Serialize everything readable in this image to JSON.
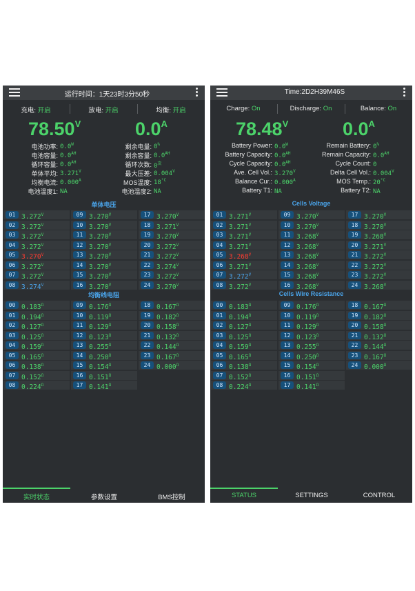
{
  "left": {
    "title": "运行时间：1天23时3分50秒",
    "toggles": [
      {
        "label": "充电:",
        "value": "开启"
      },
      {
        "label": "放电:",
        "value": "开启"
      },
      {
        "label": "均衡:",
        "value": "开启"
      }
    ],
    "voltage": {
      "value": "78.50",
      "unit": "V"
    },
    "current": {
      "value": "0.0",
      "unit": "A"
    },
    "stats_left": [
      {
        "label": "电池功率:",
        "value": "0.0",
        "unit": "W"
      },
      {
        "label": "电池容量:",
        "value": "0.0",
        "unit": "AH"
      },
      {
        "label": "循环容量:",
        "value": "0.0",
        "unit": "AH"
      },
      {
        "label": "单体平均:",
        "value": "3.271",
        "unit": "V"
      },
      {
        "label": "均衡电流:",
        "value": "0.000",
        "unit": "A"
      },
      {
        "label": "电池温度1:",
        "value": "NA",
        "unit": ""
      }
    ],
    "stats_right": [
      {
        "label": "剩余电量:",
        "value": "0",
        "unit": "%"
      },
      {
        "label": "剩余容量:",
        "value": "0.0",
        "unit": "AH"
      },
      {
        "label": "循环次数:",
        "value": "0",
        "unit": "次"
      },
      {
        "label": "最大压差:",
        "value": "0.004",
        "unit": "V"
      },
      {
        "label": "MOS温度:",
        "value": "18",
        "unit": "°C"
      },
      {
        "label": "电池温度2:",
        "value": "NA",
        "unit": ""
      }
    ],
    "cells_title": "单体电压",
    "cells": [
      {
        "id": "01",
        "value": "3.272",
        "unit": "V",
        "color": "green"
      },
      {
        "id": "09",
        "value": "3.270",
        "unit": "V",
        "color": "green"
      },
      {
        "id": "17",
        "value": "3.270",
        "unit": "V",
        "color": "green"
      },
      {
        "id": "02",
        "value": "3.272",
        "unit": "V",
        "color": "green"
      },
      {
        "id": "10",
        "value": "3.270",
        "unit": "V",
        "color": "green"
      },
      {
        "id": "18",
        "value": "3.271",
        "unit": "V",
        "color": "green"
      },
      {
        "id": "03",
        "value": "3.272",
        "unit": "V",
        "color": "green"
      },
      {
        "id": "11",
        "value": "3.270",
        "unit": "V",
        "color": "green"
      },
      {
        "id": "19",
        "value": "3.270",
        "unit": "V",
        "color": "green"
      },
      {
        "id": "04",
        "value": "3.272",
        "unit": "V",
        "color": "green"
      },
      {
        "id": "12",
        "value": "3.270",
        "unit": "V",
        "color": "green"
      },
      {
        "id": "20",
        "value": "3.272",
        "unit": "V",
        "color": "green"
      },
      {
        "id": "05",
        "value": "3.270",
        "unit": "V",
        "color": "red"
      },
      {
        "id": "13",
        "value": "3.270",
        "unit": "V",
        "color": "green"
      },
      {
        "id": "21",
        "value": "3.272",
        "unit": "V",
        "color": "green"
      },
      {
        "id": "06",
        "value": "3.272",
        "unit": "V",
        "color": "green"
      },
      {
        "id": "14",
        "value": "3.270",
        "unit": "V",
        "color": "green"
      },
      {
        "id": "22",
        "value": "3.274",
        "unit": "V",
        "color": "green"
      },
      {
        "id": "07",
        "value": "3.272",
        "unit": "V",
        "color": "green"
      },
      {
        "id": "15",
        "value": "3.270",
        "unit": "V",
        "color": "green"
      },
      {
        "id": "23",
        "value": "3.272",
        "unit": "V",
        "color": "green"
      },
      {
        "id": "08",
        "value": "3.274",
        "unit": "V",
        "color": "blue"
      },
      {
        "id": "16",
        "value": "3.270",
        "unit": "V",
        "color": "green"
      },
      {
        "id": "24",
        "value": "3.270",
        "unit": "V",
        "color": "green"
      }
    ],
    "res_title": "均衡线电阻",
    "res": [
      {
        "id": "00",
        "value": "0.183",
        "unit": "Ω"
      },
      {
        "id": "09",
        "value": "0.176",
        "unit": "Ω"
      },
      {
        "id": "18",
        "value": "0.167",
        "unit": "Ω"
      },
      {
        "id": "01",
        "value": "0.194",
        "unit": "Ω"
      },
      {
        "id": "10",
        "value": "0.119",
        "unit": "Ω"
      },
      {
        "id": "19",
        "value": "0.182",
        "unit": "Ω"
      },
      {
        "id": "02",
        "value": "0.127",
        "unit": "Ω"
      },
      {
        "id": "11",
        "value": "0.129",
        "unit": "Ω"
      },
      {
        "id": "20",
        "value": "0.158",
        "unit": "Ω"
      },
      {
        "id": "03",
        "value": "0.125",
        "unit": "Ω"
      },
      {
        "id": "12",
        "value": "0.123",
        "unit": "Ω"
      },
      {
        "id": "21",
        "value": "0.132",
        "unit": "Ω"
      },
      {
        "id": "04",
        "value": "0.159",
        "unit": "Ω"
      },
      {
        "id": "13",
        "value": "0.255",
        "unit": "Ω"
      },
      {
        "id": "22",
        "value": "0.144",
        "unit": "Ω"
      },
      {
        "id": "05",
        "value": "0.165",
        "unit": "Ω"
      },
      {
        "id": "14",
        "value": "0.250",
        "unit": "Ω"
      },
      {
        "id": "23",
        "value": "0.167",
        "unit": "Ω"
      },
      {
        "id": "06",
        "value": "0.138",
        "unit": "Ω"
      },
      {
        "id": "15",
        "value": "0.154",
        "unit": "Ω"
      },
      {
        "id": "24",
        "value": "0.000",
        "unit": "Ω"
      },
      {
        "id": "07",
        "value": "0.152",
        "unit": "Ω"
      },
      {
        "id": "16",
        "value": "0.151",
        "unit": "Ω"
      },
      {
        "id": "08",
        "value": "0.224",
        "unit": "Ω"
      },
      {
        "id": "17",
        "value": "0.141",
        "unit": "Ω"
      }
    ],
    "nav": [
      "实时状态",
      "参数设置",
      "BMS控制"
    ]
  },
  "right": {
    "title": "Time:2D2H39M46S",
    "toggles": [
      {
        "label": "Charge:",
        "value": "On"
      },
      {
        "label": "Discharge:",
        "value": "On"
      },
      {
        "label": "Balance:",
        "value": "On"
      }
    ],
    "voltage": {
      "value": "78.48",
      "unit": "V"
    },
    "current": {
      "value": "0.0",
      "unit": "A"
    },
    "stats_left": [
      {
        "label": "Battery Power:",
        "value": "0.0",
        "unit": "W"
      },
      {
        "label": "Battery Capacity:",
        "value": "0.0",
        "unit": "AH"
      },
      {
        "label": "Cycle Capacity:",
        "value": "0.0",
        "unit": "AH"
      },
      {
        "label": "Ave. Cell Vol.:",
        "value": "3.270",
        "unit": "V"
      },
      {
        "label": "Balance Cur.:",
        "value": "0.000",
        "unit": "A"
      },
      {
        "label": "Battery T1:",
        "value": "NA",
        "unit": ""
      }
    ],
    "stats_right": [
      {
        "label": "Remain Battery:",
        "value": "0",
        "unit": "%"
      },
      {
        "label": "Remain Capacity:",
        "value": "0.0",
        "unit": "AH"
      },
      {
        "label": "Cycle Count:",
        "value": "0",
        "unit": ""
      },
      {
        "label": "Delta Cell Vol.:",
        "value": "0.004",
        "unit": "V"
      },
      {
        "label": "MOS Temp.:",
        "value": "20",
        "unit": "°C"
      },
      {
        "label": "Battery T2:",
        "value": "NA",
        "unit": ""
      }
    ],
    "cells_title": "Cells Voltage",
    "cells": [
      {
        "id": "01",
        "value": "3.271",
        "unit": "V",
        "color": "green"
      },
      {
        "id": "09",
        "value": "3.270",
        "unit": "V",
        "color": "green"
      },
      {
        "id": "17",
        "value": "3.270",
        "unit": "V",
        "color": "green"
      },
      {
        "id": "02",
        "value": "3.271",
        "unit": "V",
        "color": "green"
      },
      {
        "id": "10",
        "value": "3.270",
        "unit": "V",
        "color": "green"
      },
      {
        "id": "18",
        "value": "3.270",
        "unit": "V",
        "color": "green"
      },
      {
        "id": "03",
        "value": "3.271",
        "unit": "V",
        "color": "green"
      },
      {
        "id": "11",
        "value": "3.268",
        "unit": "V",
        "color": "green"
      },
      {
        "id": "19",
        "value": "3.268",
        "unit": "V",
        "color": "green"
      },
      {
        "id": "04",
        "value": "3.271",
        "unit": "V",
        "color": "green"
      },
      {
        "id": "12",
        "value": "3.268",
        "unit": "V",
        "color": "green"
      },
      {
        "id": "20",
        "value": "3.271",
        "unit": "V",
        "color": "green"
      },
      {
        "id": "05",
        "value": "3.268",
        "unit": "V",
        "color": "red"
      },
      {
        "id": "13",
        "value": "3.268",
        "unit": "V",
        "color": "green"
      },
      {
        "id": "21",
        "value": "3.272",
        "unit": "V",
        "color": "green"
      },
      {
        "id": "06",
        "value": "3.271",
        "unit": "V",
        "color": "green"
      },
      {
        "id": "14",
        "value": "3.268",
        "unit": "V",
        "color": "green"
      },
      {
        "id": "22",
        "value": "3.272",
        "unit": "V",
        "color": "green"
      },
      {
        "id": "07",
        "value": "3.272",
        "unit": "V",
        "color": "blue"
      },
      {
        "id": "15",
        "value": "3.268",
        "unit": "V",
        "color": "green"
      },
      {
        "id": "23",
        "value": "3.272",
        "unit": "V",
        "color": "green"
      },
      {
        "id": "08",
        "value": "3.272",
        "unit": "V",
        "color": "green"
      },
      {
        "id": "16",
        "value": "3.268",
        "unit": "V",
        "color": "green"
      },
      {
        "id": "24",
        "value": "3.268",
        "unit": "V",
        "color": "green"
      }
    ],
    "res_title": "Cells Wire Resistance",
    "res": [
      {
        "id": "00",
        "value": "0.183",
        "unit": "Ω"
      },
      {
        "id": "09",
        "value": "0.176",
        "unit": "Ω"
      },
      {
        "id": "18",
        "value": "0.167",
        "unit": "Ω"
      },
      {
        "id": "01",
        "value": "0.194",
        "unit": "Ω"
      },
      {
        "id": "10",
        "value": "0.119",
        "unit": "Ω"
      },
      {
        "id": "19",
        "value": "0.182",
        "unit": "Ω"
      },
      {
        "id": "02",
        "value": "0.127",
        "unit": "Ω"
      },
      {
        "id": "11",
        "value": "0.129",
        "unit": "Ω"
      },
      {
        "id": "20",
        "value": "0.158",
        "unit": "Ω"
      },
      {
        "id": "03",
        "value": "0.125",
        "unit": "Ω"
      },
      {
        "id": "12",
        "value": "0.123",
        "unit": "Ω"
      },
      {
        "id": "21",
        "value": "0.132",
        "unit": "Ω"
      },
      {
        "id": "04",
        "value": "0.159",
        "unit": "Ω"
      },
      {
        "id": "13",
        "value": "0.255",
        "unit": "Ω"
      },
      {
        "id": "22",
        "value": "0.144",
        "unit": "Ω"
      },
      {
        "id": "05",
        "value": "0.165",
        "unit": "Ω"
      },
      {
        "id": "14",
        "value": "0.250",
        "unit": "Ω"
      },
      {
        "id": "23",
        "value": "0.167",
        "unit": "Ω"
      },
      {
        "id": "06",
        "value": "0.138",
        "unit": "Ω"
      },
      {
        "id": "15",
        "value": "0.154",
        "unit": "Ω"
      },
      {
        "id": "24",
        "value": "0.000",
        "unit": "Ω"
      },
      {
        "id": "07",
        "value": "0.152",
        "unit": "Ω"
      },
      {
        "id": "16",
        "value": "0.151",
        "unit": "Ω"
      },
      {
        "id": "08",
        "value": "0.224",
        "unit": "Ω"
      },
      {
        "id": "17",
        "value": "0.141",
        "unit": "Ω"
      }
    ],
    "nav": [
      "STATUS",
      "SETTINGS",
      "CONTROL"
    ]
  },
  "colors": {
    "accent_green": "#4cd36a",
    "accent_blue": "#4aa3e8",
    "alert_red": "#ff3b30",
    "background": "#2b2e31"
  },
  "icons": {
    "menu": "hamburger-icon",
    "more": "more-vertical-icon"
  }
}
